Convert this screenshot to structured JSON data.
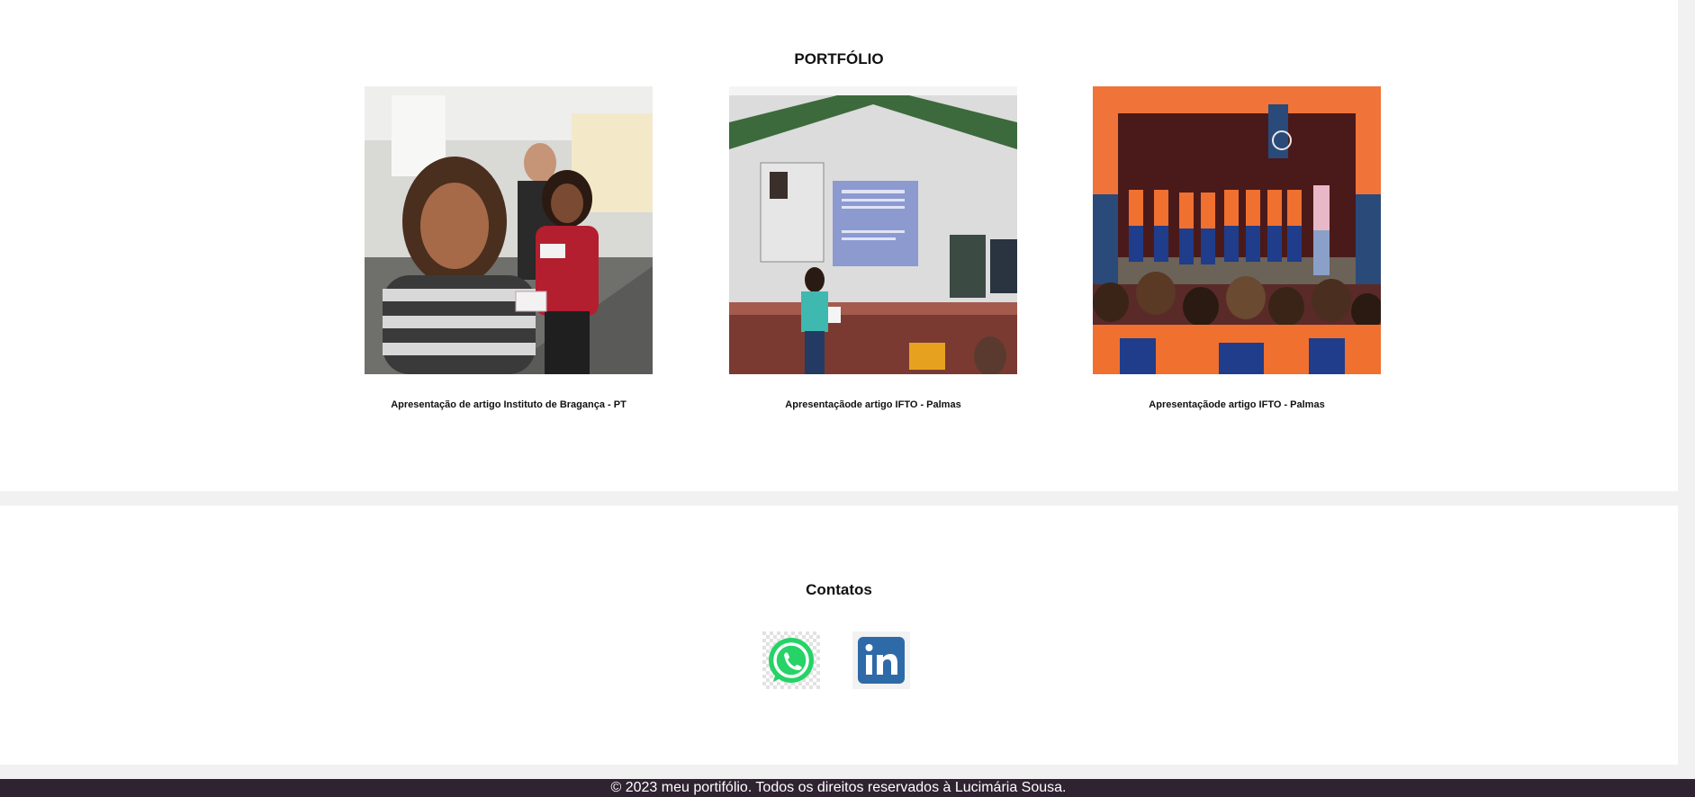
{
  "portfolio": {
    "title": "PORTFÓLIO",
    "items": [
      {
        "caption": "Apresentação de artigo Instituto de Bragança - PT",
        "photo": "selfie-photo"
      },
      {
        "caption": "Apresentaçãode artigo IFTO - Palmas",
        "photo": "presentation-photo"
      },
      {
        "caption": "Apresentaçãode artigo IFTO - Palmas",
        "photo": "students-stage-photo"
      }
    ]
  },
  "contacts": {
    "title": "Contatos",
    "links": [
      {
        "icon": "whatsapp-icon",
        "color": "#25d366"
      },
      {
        "icon": "linkedin-icon",
        "color": "#2e6aa8"
      }
    ]
  },
  "footer": {
    "text": "© 2023 meu portifólio. Todos os direitos reservados à Lucimária Sousa."
  }
}
